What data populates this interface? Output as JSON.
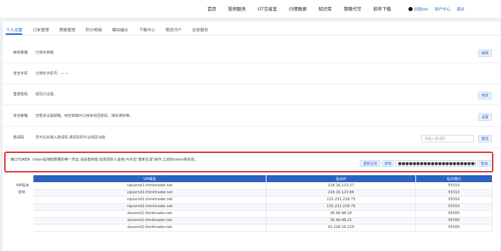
{
  "nav": {
    "items": [
      "首页",
      "投研服务",
      "GT交易室",
      "行情数据",
      "知识库",
      "策略代写",
      "软件下载"
    ],
    "username": "迅投kiki",
    "user_center": "用户中心",
    "logout": "退出"
  },
  "tabs": [
    "个人设置",
    "订单管理",
    "策略管理",
    "积分明细",
    "模拟撮合",
    "下载中心",
    "期货开户",
    "全部服务"
  ],
  "rows": {
    "email": {
      "label": "绑定邮箱",
      "desc": "已绑定邮箱",
      "button": "解绑"
    },
    "phone": {
      "label": "安全手机",
      "desc": "已绑定手机号:",
      "masked": "——"
    },
    "password": {
      "label": "登录密码",
      "desc": "密码已设置。",
      "button": "修改"
    },
    "security_email": {
      "label": "安全邮箱",
      "desc": "您暂未设置邮箱，绑定邮箱可以用来找回密码、接收通知等。",
      "button": "设置"
    },
    "invite": {
      "label": "邀请码",
      "desc": "您可在此输入邀请码,邀请投研平台相关功能",
      "placeholder": "请输入邀请码",
      "button": "激活"
    }
  },
  "token": {
    "label": "接口TOKEN",
    "desc": "token是用取数据的唯一凭证,请妥善保管,如发现别人盗用,可点击\"重新生成\"操作,之前的token将失效。",
    "regen_button": "重新生成",
    "copy_button": "复制",
    "value": "●●●●●●●●●●●●●●●●●●●●●●●●●●●●●●●●●●●●●●●●●●●●●",
    "query_button": "查询"
  },
  "vip": {
    "label": "VIP站点",
    "copy": "复制",
    "headers": [
      "VIP域名",
      "站点IP",
      "站点端口"
    ],
    "rows": [
      [
        "vipsxmd1.thinktrader.net",
        "218.16.123.27",
        "55310"
      ],
      [
        "vipsxmd2.thinktrader.net",
        "218.16.123.86",
        "55310"
      ],
      [
        "vipsxmd1.thinktrader.net",
        "115.231.218.73",
        "55310"
      ],
      [
        "vipsxmd2.thinktrader.net",
        "115.231.218.79",
        "55310"
      ],
      [
        "dxzxmd1.thinktrader.net",
        "36.99.48.20",
        "55300"
      ],
      [
        "dxzxmd2.thinktrader.net",
        "36.99.48.21",
        "55300"
      ],
      [
        "dxzxmd3.thinktrader.net",
        "42.228.16.210",
        "55300"
      ]
    ]
  }
}
